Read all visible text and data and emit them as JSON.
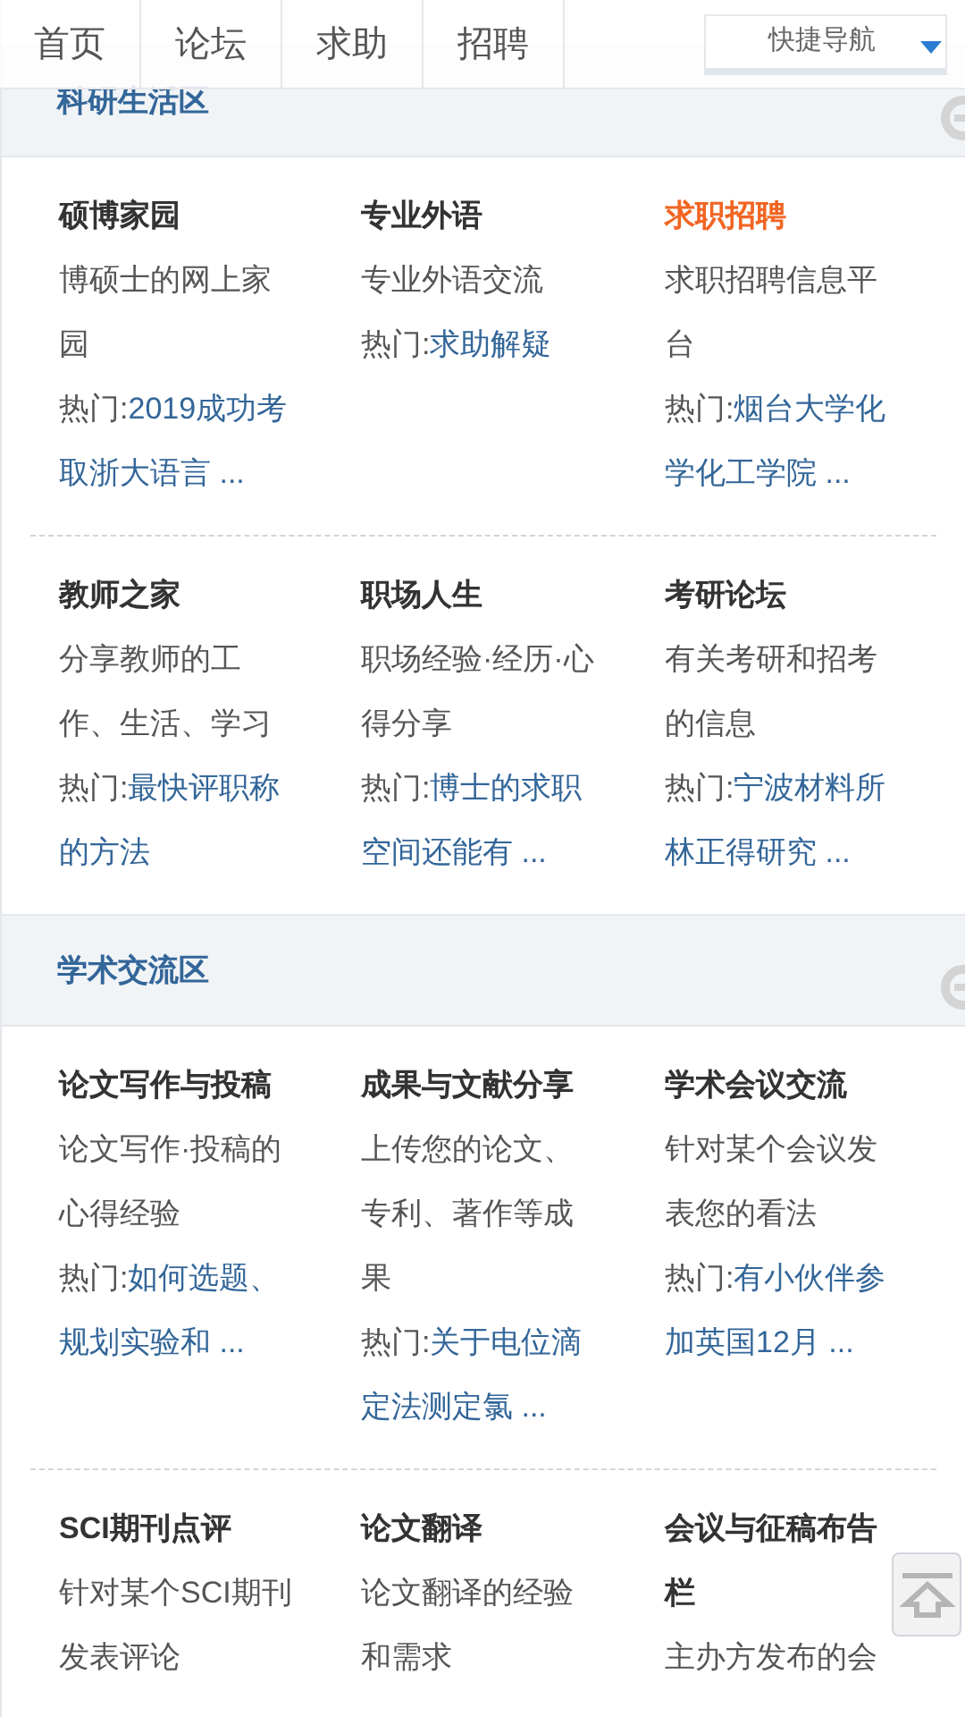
{
  "nav": {
    "tabs": [
      {
        "label": "首页"
      },
      {
        "label": "论坛"
      },
      {
        "label": "求助"
      },
      {
        "label": "招聘"
      }
    ],
    "quick_nav": {
      "label": "快捷导航"
    }
  },
  "sections": [
    {
      "title": "科研生活区",
      "rows": [
        [
          {
            "title": "硕博家园",
            "highlighted": false,
            "description": "博硕士的网上家园",
            "hot_label": "热门:",
            "hot_link": "2019成功考取浙大语言 ..."
          },
          {
            "title": "专业外语",
            "highlighted": false,
            "description": "专业外语交流",
            "hot_label": "热门:",
            "hot_link": "求助解疑"
          },
          {
            "title": "求职招聘",
            "highlighted": true,
            "description": "求职招聘信息平台",
            "hot_label": "热门:",
            "hot_link": "烟台大学化学化工学院 ..."
          }
        ],
        [
          {
            "title": "教师之家",
            "highlighted": false,
            "description": "分享教师的工作、生活、学习",
            "hot_label": "热门:",
            "hot_link": "最快评职称的方法"
          },
          {
            "title": "职场人生",
            "highlighted": false,
            "description": "职场经验·经历·心得分享",
            "hot_label": "热门:",
            "hot_link": "博士的求职空间还能有 ..."
          },
          {
            "title": "考研论坛",
            "highlighted": false,
            "description": "有关考研和招考的信息",
            "hot_label": "热门:",
            "hot_link": "宁波材料所林正得研究 ..."
          }
        ]
      ]
    },
    {
      "title": "学术交流区",
      "rows": [
        [
          {
            "title": "论文写作与投稿",
            "highlighted": false,
            "description": "论文写作·投稿的心得经验",
            "hot_label": "热门:",
            "hot_link": "如何选题、规划实验和 ..."
          },
          {
            "title": "成果与文献分享",
            "highlighted": false,
            "description": "上传您的论文、专利、著作等成果",
            "hot_label": "热门:",
            "hot_link": "关于电位滴定法测定氯 ..."
          },
          {
            "title": "学术会议交流",
            "highlighted": false,
            "description": "针对某个会议发表您的看法",
            "hot_label": "热门:",
            "hot_link": "有小伙伴参加英国12月 ..."
          }
        ],
        [
          {
            "title": "SCI期刊点评",
            "highlighted": false,
            "description": "针对某个SCI期刊发表评论"
          },
          {
            "title": "论文翻译",
            "highlighted": false,
            "description": "论文翻译的经验和需求"
          },
          {
            "title": "会议与征稿布告栏",
            "highlighted": false,
            "description": "主办方发布的会"
          }
        ]
      ]
    }
  ]
}
